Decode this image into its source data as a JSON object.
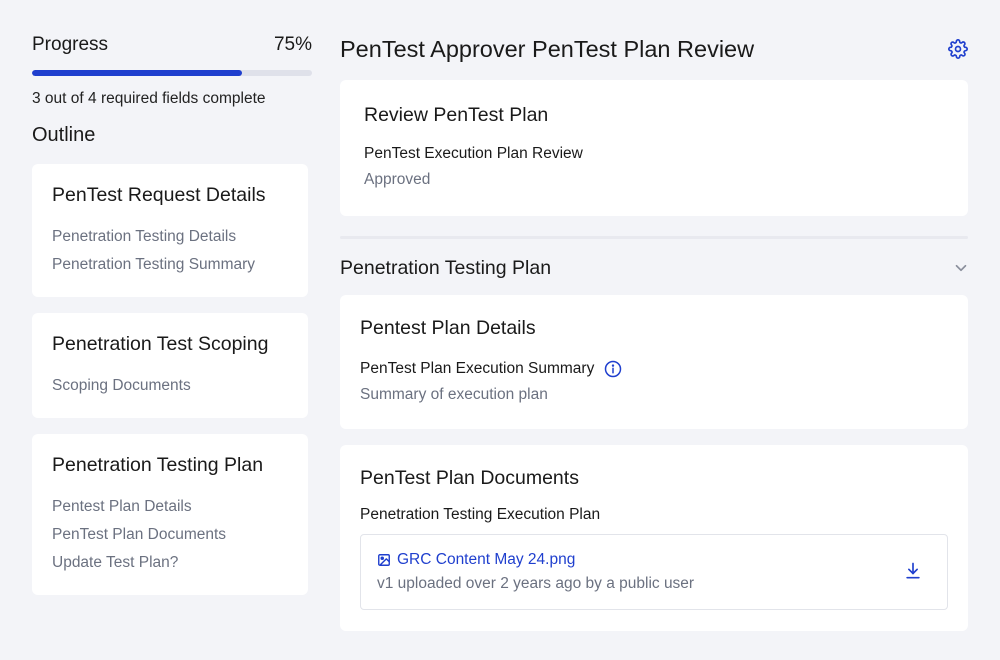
{
  "sidebar": {
    "progress_label": "Progress",
    "progress_percent_text": "75%",
    "progress_value": 0.75,
    "progress_summary": "3 out of 4 required fields complete",
    "outline_title": "Outline",
    "sections": [
      {
        "title": "PenTest Request Details",
        "items": [
          "Penetration Testing Details",
          "Penetration Testing Summary"
        ]
      },
      {
        "title": "Penetration Test Scoping",
        "items": [
          "Scoping Documents"
        ]
      },
      {
        "title": "Penetration Testing Plan",
        "items": [
          "Pentest Plan Details",
          "PenTest Plan Documents",
          "Update Test Plan?"
        ]
      }
    ]
  },
  "main": {
    "page_title": "PenTest Approver PenTest Plan Review",
    "settings_icon": "gear-icon",
    "review_card": {
      "title": "Review PenTest Plan",
      "field_label": "PenTest Execution Plan Review",
      "field_value": "Approved"
    },
    "plan_section": {
      "title": "Penetration Testing Plan",
      "toggle_icon": "chevron-down-icon",
      "details_card": {
        "title": "Pentest Plan Details",
        "field_label": "PenTest Plan Execution Summary",
        "field_value": "Summary of execution plan"
      },
      "documents_card": {
        "title": "PenTest Plan Documents",
        "field_label": "Penetration Testing Execution Plan",
        "file_name": "GRC Content May 24.png",
        "file_meta": "v1 uploaded over 2 years ago by a public user"
      }
    }
  },
  "colors": {
    "accent": "#1f3fce",
    "background": "#f3f4f8",
    "muted_text": "#6b7180"
  }
}
